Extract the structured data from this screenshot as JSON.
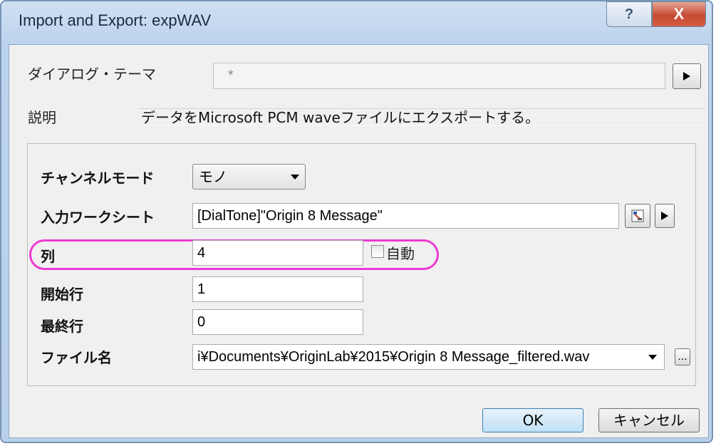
{
  "window": {
    "title": "Import and Export: expWAV",
    "help_label": "?",
    "close_label": "X"
  },
  "theme": {
    "label": "ダイアログ・テーマ",
    "value": "*"
  },
  "description": {
    "label": "説明",
    "text": "データをMicrosoft PCM waveファイルにエクスポートする。"
  },
  "fields": {
    "channel_mode": {
      "label": "チャンネルモード",
      "value": "モノ"
    },
    "input_sheet": {
      "label": "入力ワークシート",
      "value": "[DialTone]\"Origin 8 Message\""
    },
    "column": {
      "label": "列",
      "value": "4",
      "auto_label": "自動",
      "auto_checked": false
    },
    "start_row": {
      "label": "開始行",
      "value": "1"
    },
    "end_row": {
      "label": "最終行",
      "value": "0"
    },
    "file_name": {
      "label": "ファイル名",
      "value": "i¥Documents¥OriginLab¥2015¥Origin 8 Message_filtered.wav"
    }
  },
  "buttons": {
    "ok": "OK",
    "cancel": "キャンセル",
    "browse": "..."
  },
  "colors": {
    "highlight": "#ee3ad3",
    "title_bar": "#bcd3ec",
    "close_button": "#c54a32"
  }
}
